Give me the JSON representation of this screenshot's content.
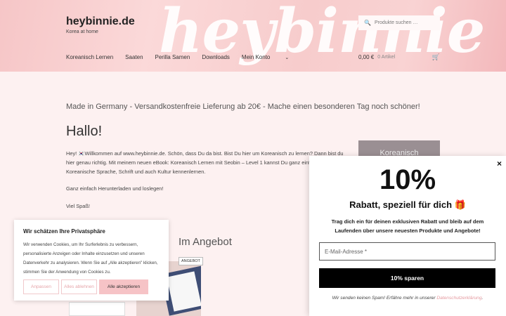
{
  "header": {
    "site_title": "heybinnie.de",
    "tagline": "Korea at home",
    "watermark": "heybinnie",
    "search_placeholder": "Produkte suchen …",
    "nav": [
      "Koreanisch Lernen",
      "Saaten",
      "Perilla Samen",
      "Downloads",
      "Mein Konto"
    ],
    "cart_total": "0,00 €",
    "cart_count": "0 Artikel"
  },
  "main": {
    "notice": "Made in Germany - Versandkostenfreie Lieferung ab 20€ - Mache einen besonderen Tag noch schöner!",
    "heading": "Hallo!",
    "para1": "Hey! 🇰🇷Willkommen auf www.heybinnie.de. Schön, dass Du da bist. Bist Du hier um Koreanisch zu lernen? Dann bist du hier genau richtig. Mit meinem neuen eBook: Koreanisch Lernen mit Seobin – Level 1 kannst Du ganz einfach die Koreanische Sprache, Schrift und auch Kultur kennenlernen.",
    "para2": "Ganz einfach Herunterladen und loslegen!",
    "para3": "Viel Spaß!",
    "side_banner": "Koreanisch",
    "offer_heading": "Im Angebot",
    "badge": "ANGEBOT"
  },
  "cookie": {
    "title": "Wir schätzen Ihre Privatsphäre",
    "text": "Wir verwenden Cookies, um Ihr Surferlebnis zu verbessern, personalisierte Anzeigen oder Inhalte einzusetzen und unseren Datenverkehr zu analysieren. Wenn Sie auf „Alle akzeptieren\" klicken, stimmen Sie der Anwendung von Cookies zu.",
    "btn_customize": "Anpassen",
    "btn_reject": "Alles ablehnen",
    "btn_accept": "Alle akzeptieren"
  },
  "popup": {
    "close": "×",
    "big": "10%",
    "headline": "Rabatt, speziell für dich",
    "gift": "🎁",
    "description": "Trag dich ein für deinen exklusiven Rabatt und bleib auf dem Laufenden über unsere neuesten Produkte und Angebote!",
    "email_placeholder": "E-Mail-Adresse *",
    "button": "10% sparen",
    "nospam": "Wir senden keinen Spam! Erfähre mehr in unserer ",
    "privacy_link": "Datenschutzerklärung",
    "period": "."
  }
}
